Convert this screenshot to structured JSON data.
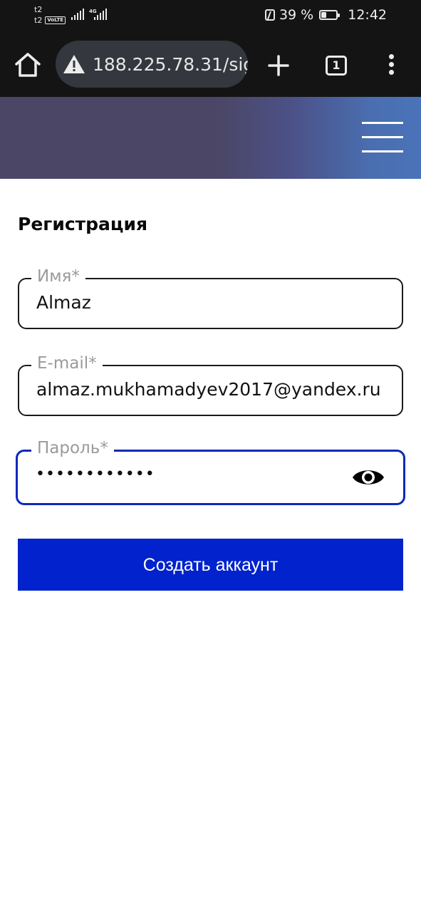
{
  "status_bar": {
    "carrier_1": "t2",
    "carrier_2": "t2",
    "volte_badge": "VoLTE",
    "network_tag": "4G",
    "battery_percent": "39 %",
    "time": "12:42"
  },
  "browser": {
    "url": "188.225.78.31/sig",
    "tab_count": "1"
  },
  "page": {
    "title": "Регистрация"
  },
  "form": {
    "name_label": "Имя*",
    "name_value": "Almaz",
    "email_label": "E-mail*",
    "email_value": "almaz.mukhamadyev2017@yandex.ru",
    "password_label": "Пароль*",
    "password_value": "••••••••••••",
    "submit_label": "Создать аккаунт"
  },
  "colors": {
    "accent": "#0122cc",
    "focus_border": "#0a2ab8",
    "header_left": "#4b4666",
    "header_right": "#4a73b9"
  },
  "icons": [
    "home-icon",
    "warning-icon",
    "plus-icon",
    "tabs-icon",
    "more-vert-icon",
    "menu-icon",
    "eye-icon",
    "nfc-icon",
    "battery-icon",
    "signal-icon"
  ]
}
